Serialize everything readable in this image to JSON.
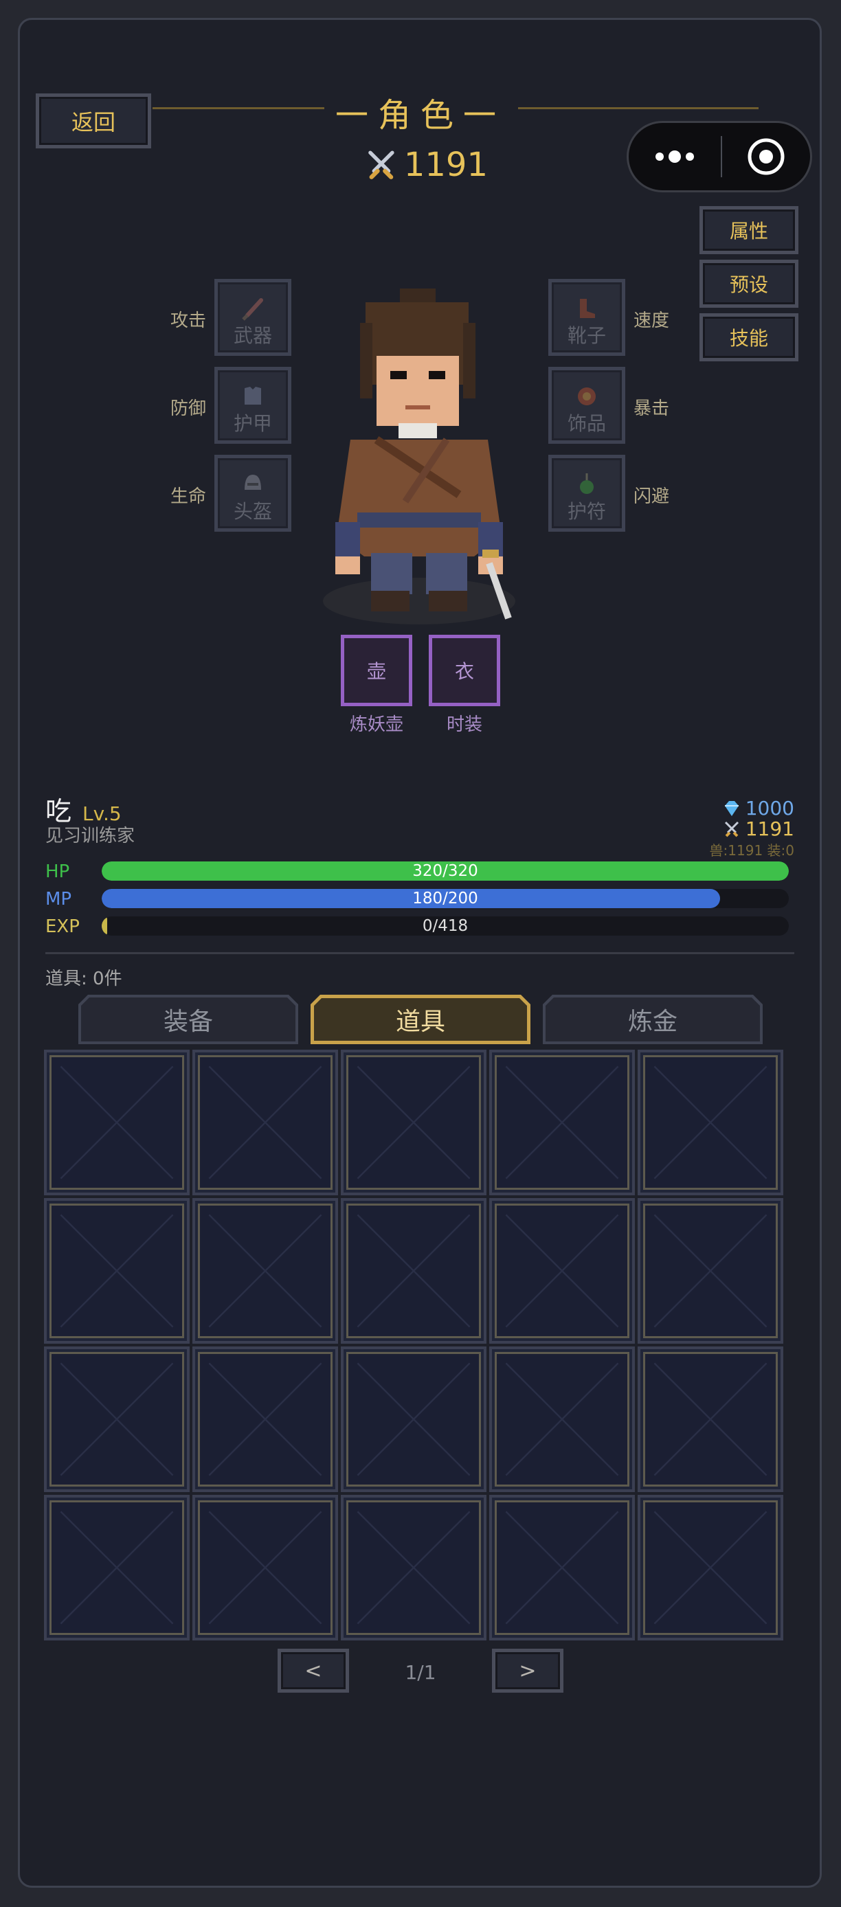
{
  "header": {
    "back_label": "返回",
    "title": "一角色一",
    "power": "1191"
  },
  "capsule": {
    "more_icon": "more-dots-icon",
    "close_icon": "target-circle-icon"
  },
  "side_buttons": [
    "属性",
    "预设",
    "技能"
  ],
  "equipment": {
    "left": [
      {
        "stat": "攻击",
        "slot": "武器",
        "icon": "sword-icon"
      },
      {
        "stat": "防御",
        "slot": "护甲",
        "icon": "armor-icon"
      },
      {
        "stat": "生命",
        "slot": "头盔",
        "icon": "helmet-icon"
      }
    ],
    "right": [
      {
        "stat": "速度",
        "slot": "靴子",
        "icon": "boots-icon"
      },
      {
        "stat": "暴击",
        "slot": "饰品",
        "icon": "accessory-icon"
      },
      {
        "stat": "闪避",
        "slot": "护符",
        "icon": "amulet-icon"
      }
    ],
    "special": [
      {
        "glyph": "壶",
        "label": "炼妖壶"
      },
      {
        "glyph": "衣",
        "label": "时装"
      }
    ]
  },
  "character": {
    "name": "吃",
    "level": "Lv.5",
    "title": "见习训练家",
    "gems": "1000",
    "power": "1191",
    "detail": "兽:1191 装:0"
  },
  "bars": [
    {
      "label": "HP",
      "text": "320/320",
      "value": 320,
      "max": 320,
      "color": "#3ec04a",
      "label_color": "#3ec04a"
    },
    {
      "label": "MP",
      "text": "180/200",
      "value": 180,
      "max": 200,
      "color": "#3d6fd6",
      "label_color": "#5b8de8"
    },
    {
      "label": "EXP",
      "text": "0/418",
      "value": 0,
      "max": 418,
      "color": "#c9b84a",
      "label_color": "#d6c25a"
    }
  ],
  "inventory": {
    "count_label": "道具: 0件",
    "tabs": [
      "装备",
      "道具",
      "炼金"
    ],
    "active_tab": 1,
    "page": "1/1",
    "prev_label": "<",
    "next_label": ">"
  }
}
